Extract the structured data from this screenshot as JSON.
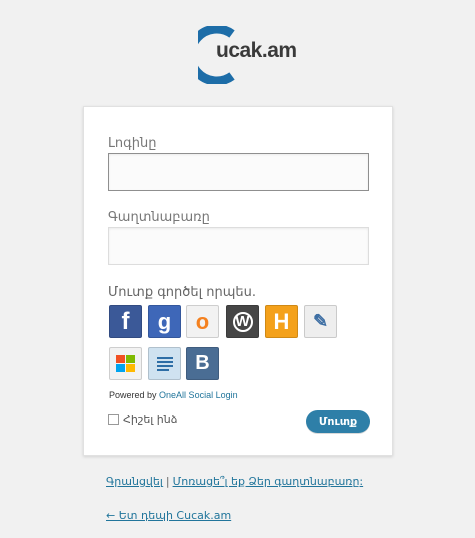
{
  "logo": {
    "prefix": "ucak",
    "highlight": "",
    "suffix": ".am"
  },
  "form": {
    "username_label": "Լոգինը",
    "password_label": "Գաղտնաբառը",
    "username_value": "",
    "password_value": "",
    "social_title": "Մուտք գործել որպես.",
    "powered_prefix": "Powered by",
    "powered_link": "OneAll Social Login",
    "remember_label": "Հիշել ինձ",
    "submit_label": "Մուտք"
  },
  "social": [
    {
      "icon": "facebook-icon",
      "glyph": "f",
      "color": "#3b5998"
    },
    {
      "icon": "google-icon",
      "glyph": "g",
      "color": "#3e67b8"
    },
    {
      "icon": "openid-icon",
      "glyph": "o",
      "color": "#f2f2f2"
    },
    {
      "icon": "wordpress-icon",
      "glyph": "W",
      "color": "#464646"
    },
    {
      "icon": "hyves-icon",
      "glyph": "H",
      "color": "#f4a11b"
    },
    {
      "icon": "livejournal-icon",
      "glyph": "✎",
      "color": "#f0f0f0"
    },
    {
      "icon": "windows-live-icon",
      "glyph": "",
      "color": "#f2f2f2"
    },
    {
      "icon": "blogger-feed-icon",
      "glyph": "",
      "color": "#cfe2f0"
    },
    {
      "icon": "vkontakte-icon",
      "glyph": "B",
      "color": "#4a6d94"
    }
  ],
  "footer": {
    "register": "Գրանցվել",
    "separator": "|",
    "lost_password": "Մոռացե՞լ եք Ձեր գաղտնաբառը:",
    "back_link": "← Ետ դեպի Cucak.am"
  }
}
